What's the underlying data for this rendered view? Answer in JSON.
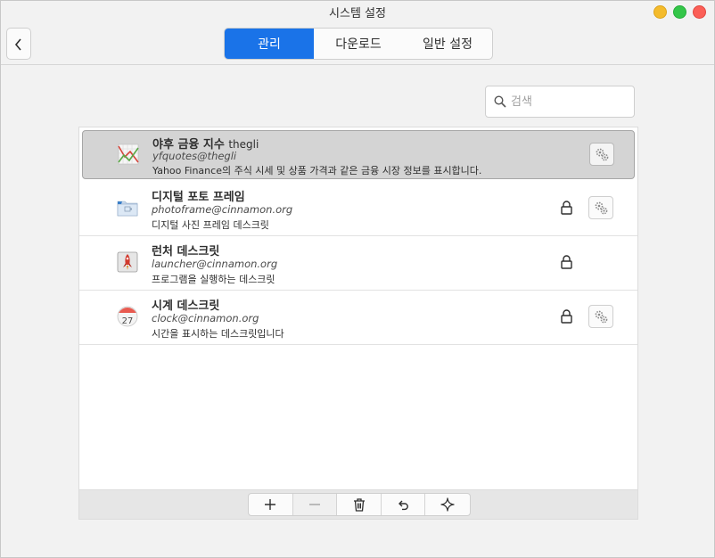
{
  "window": {
    "title": "시스템 설정"
  },
  "tabs": [
    {
      "label": "관리",
      "active": true
    },
    {
      "label": "다운로드",
      "active": false
    },
    {
      "label": "일반 설정",
      "active": false
    }
  ],
  "search": {
    "placeholder": "검색",
    "value": ""
  },
  "desklets": [
    {
      "name": "야후 금융 지수",
      "author": "thegli",
      "uuid": "yfquotes@thegli",
      "description": "Yahoo Finance의 주식 시세 및 상품 가격과 같은 금융 시장 정보를 표시합니다.",
      "icon": "chart-icon",
      "selected": true,
      "locked": false,
      "configurable": true
    },
    {
      "name": "디지털 포토 프레임",
      "author": "",
      "uuid": "photoframe@cinnamon.org",
      "description": "디지털 사진 프레임 데스크릿",
      "icon": "folder-photo-icon",
      "selected": false,
      "locked": true,
      "configurable": true
    },
    {
      "name": "런처 데스크릿",
      "author": "",
      "uuid": "launcher@cinnamon.org",
      "description": "프로그램을 실행하는 데스크릿",
      "icon": "rocket-icon",
      "selected": false,
      "locked": true,
      "configurable": false
    },
    {
      "name": "시계 데스크릿",
      "author": "",
      "uuid": "clock@cinnamon.org",
      "description": "시간을 표시하는 데스크릿입니다",
      "icon": "calendar-icon",
      "calendar_day": "27",
      "selected": false,
      "locked": true,
      "configurable": true
    }
  ],
  "toolbar": [
    "add-icon",
    "remove-icon",
    "trash-icon",
    "undo-icon",
    "sparkle-icon"
  ],
  "colors": {
    "accent": "#1a73e8",
    "selected_row": "#d4d4d4"
  }
}
